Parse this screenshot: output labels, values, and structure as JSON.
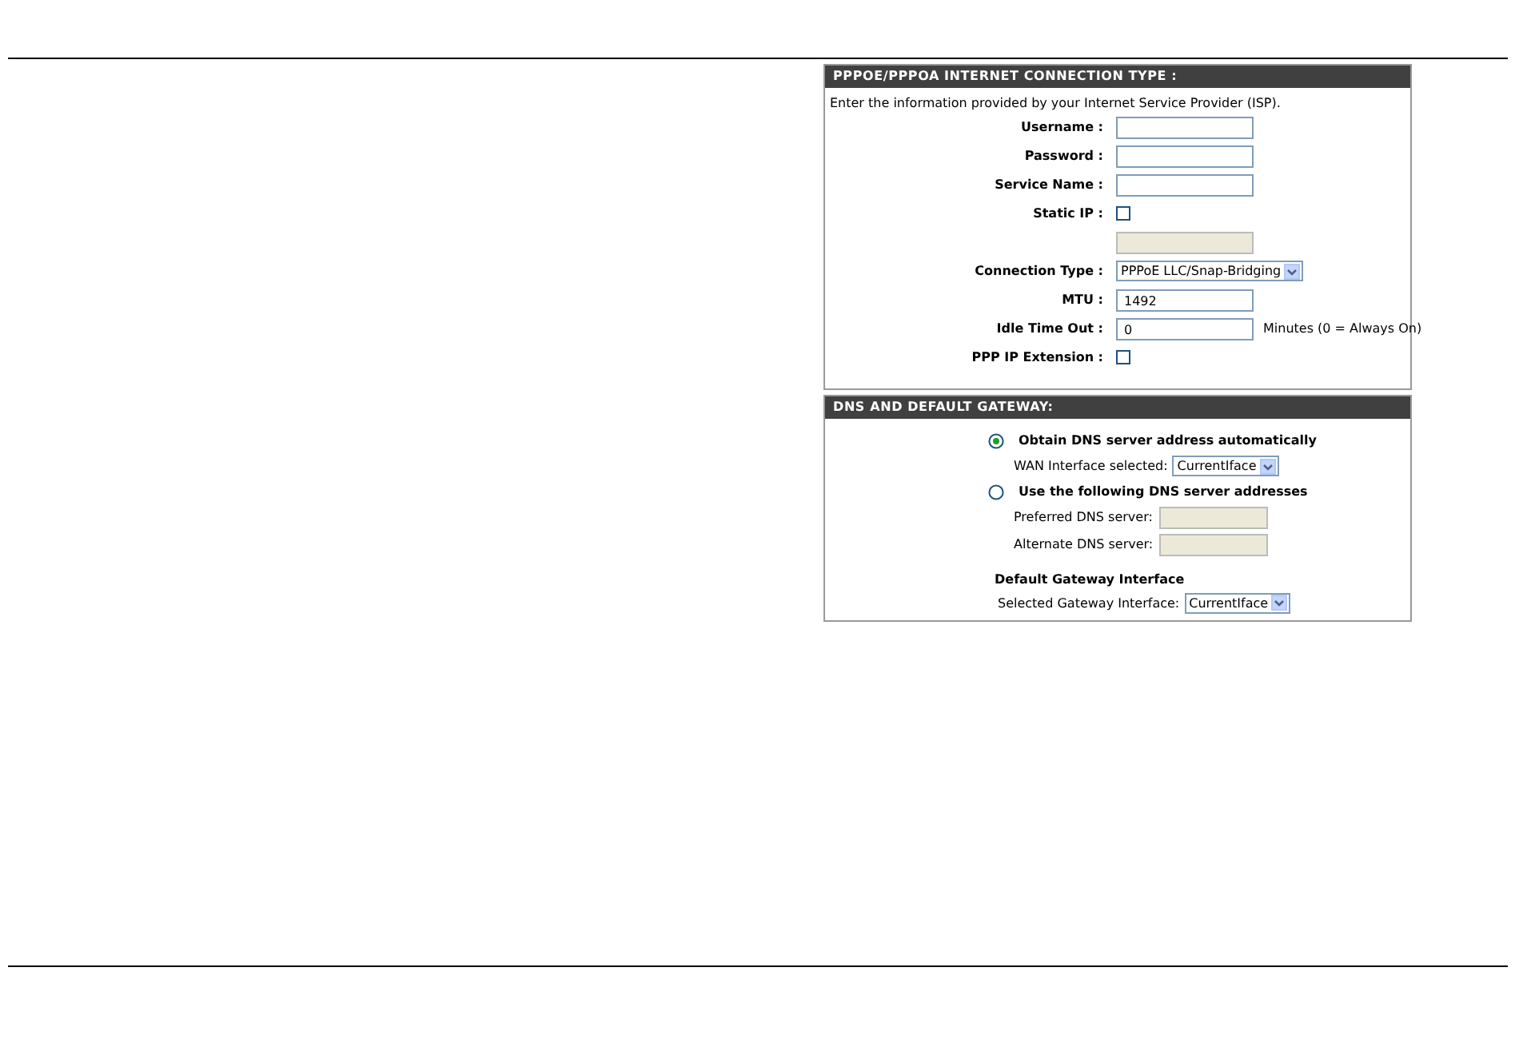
{
  "connection": {
    "title": "PPPOE/PPPOA INTERNET CONNECTION TYPE :",
    "intro": "Enter the information provided by your Internet Service Provider (ISP).",
    "fields": [
      {
        "kind": "text",
        "label": "Username :",
        "disabled": false
      },
      {
        "kind": "text",
        "label": "Password :",
        "disabled": false
      },
      {
        "kind": "text",
        "label": "Service Name :",
        "disabled": false
      },
      {
        "kind": "checkbox",
        "label": "Static IP :",
        "checked": false
      },
      {
        "kind": "text",
        "disabled": true
      },
      {
        "kind": "select",
        "label": "Connection Type :",
        "value": "PPPoE LLC/Snap-Bridging"
      },
      {
        "kind": "text",
        "label": "MTU :",
        "value": "1492",
        "disabled": false
      },
      {
        "kind": "text",
        "label": "Idle Time Out :",
        "value": "0",
        "disabled": false,
        "suffix": "Minutes (0 = Always On)"
      },
      {
        "kind": "checkbox",
        "label": "PPP IP Extension :",
        "checked": false
      }
    ]
  },
  "dns": {
    "title": "DNS AND DEFAULT GATEWAY:",
    "options": [
      {
        "label": "Obtain DNS server address automatically",
        "selected": true,
        "fields": [
          {
            "kind": "select",
            "label": "WAN Interface selected:",
            "value": "CurrentIface"
          }
        ]
      },
      {
        "label": "Use the following DNS server addresses",
        "selected": false,
        "fields": [
          {
            "kind": "text",
            "label": "Preferred DNS server:",
            "disabled": true
          },
          {
            "kind": "text",
            "label": "Alternate DNS server:",
            "disabled": true
          }
        ]
      }
    ],
    "gateway": {
      "title": "Default Gateway Interface",
      "label": "Selected Gateway Interface:",
      "value": "CurrentIface"
    }
  }
}
